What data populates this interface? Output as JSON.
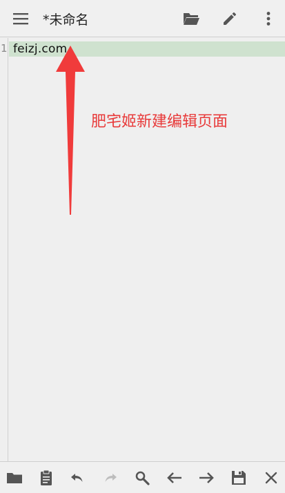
{
  "header": {
    "title": "*未命名",
    "menu_icon": "hamburger-menu-icon",
    "open_icon": "folder-open-icon",
    "edit_icon": "pencil-icon",
    "more_icon": "more-vertical-icon"
  },
  "editor": {
    "line_numbers": [
      "1"
    ],
    "lines": [
      "feizj.com"
    ],
    "current_line_color": "#cfe2cf"
  },
  "annotation": {
    "label": "肥宅姬新建编辑页面",
    "color": "#e83a3a"
  },
  "toolbar": {
    "icons": [
      "folder-icon",
      "clipboard-icon",
      "undo-icon",
      "redo-icon",
      "search-icon",
      "arrow-left-icon",
      "arrow-right-icon",
      "save-icon",
      "close-icon"
    ]
  }
}
